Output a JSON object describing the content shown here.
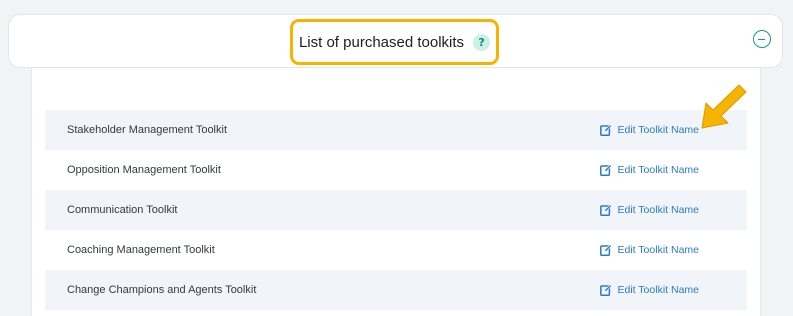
{
  "header": {
    "title": "List of purchased toolkits",
    "help_glyph": "?",
    "collapse_icon": "minus-circle-icon"
  },
  "colors": {
    "highlight_border": "#f5b400",
    "accent": "#1a9b7e",
    "link": "#2b7bc4",
    "arrow": "#f5b400"
  },
  "toolkits": [
    {
      "name": "Stakeholder Management Toolkit",
      "action": "Edit Toolkit Name"
    },
    {
      "name": "Opposition Management Toolkit",
      "action": "Edit Toolkit Name"
    },
    {
      "name": "Communication Toolkit",
      "action": "Edit Toolkit Name"
    },
    {
      "name": "Coaching Management Toolkit",
      "action": "Edit Toolkit Name"
    },
    {
      "name": "Change Champions and Agents Toolkit",
      "action": "Edit Toolkit Name"
    }
  ]
}
